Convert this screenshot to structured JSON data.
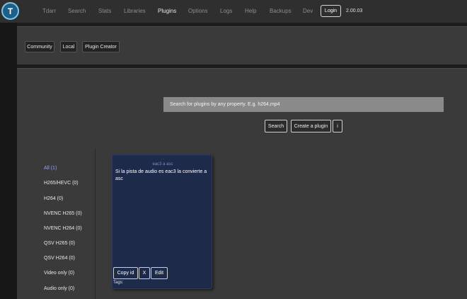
{
  "app": {
    "logo": "tdarr-logo-icon",
    "version": "2.00.03"
  },
  "nav": {
    "items": [
      {
        "label": "Tdarr",
        "active": false
      },
      {
        "label": "Search",
        "active": false
      },
      {
        "label": "Stats",
        "active": false
      },
      {
        "label": "Libraries",
        "active": false
      },
      {
        "label": "Plugins",
        "active": true
      },
      {
        "label": "Options",
        "active": false
      },
      {
        "label": "Logs",
        "active": false
      },
      {
        "label": "Help",
        "active": false
      },
      {
        "label": "Backups",
        "active": false
      },
      {
        "label": "Dev",
        "active": false
      }
    ],
    "login_label": "Login"
  },
  "plugin_tabs": [
    {
      "label": "Community"
    },
    {
      "label": "Local"
    },
    {
      "label": "Plugin Creator"
    }
  ],
  "search": {
    "placeholder": "Search for plugins by any property. E.g. h264,mp4",
    "search_label": "Search",
    "create_label": "Create a plugin",
    "info_label": "i"
  },
  "categories": [
    {
      "label": "All (1)",
      "active": true
    },
    {
      "label": "H265/HEVC (0)",
      "active": false
    },
    {
      "label": "H264 (0)",
      "active": false
    },
    {
      "label": "NVENC H265 (0)",
      "active": false
    },
    {
      "label": "NVENC H264 (0)",
      "active": false
    },
    {
      "label": "QSV H265 (0)",
      "active": false
    },
    {
      "label": "QSV H264 (0)",
      "active": false
    },
    {
      "label": "Video only (0)",
      "active": false
    },
    {
      "label": "Audio only (0)",
      "active": false
    }
  ],
  "plugin_card": {
    "id": "...",
    "name": "eac3 a asc",
    "description": "Si la pista de audio es eac3 la convierte a asc",
    "copy_id_label": "Copy id",
    "delete_label": "X",
    "edit_label": "Edit",
    "tags_label": "Tags:"
  }
}
